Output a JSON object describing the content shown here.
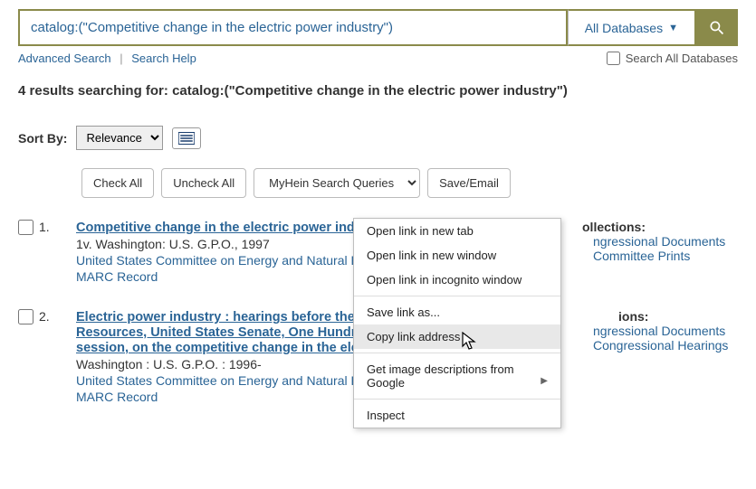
{
  "search": {
    "query": "catalog:(\"Competitive change in the electric power industry\")",
    "db_label": "All Databases",
    "advanced": "Advanced Search",
    "help": "Search Help",
    "search_all": "Search All Databases"
  },
  "results_header": {
    "prefix": "4 results searching for: ",
    "query": "catalog:(\"Competitive change in the electric power industry\")"
  },
  "sort": {
    "label": "Sort By:",
    "value": "Relevance"
  },
  "actions": {
    "check_all": "Check All",
    "uncheck_all": "Uncheck All",
    "myhein": "MyHein Search Queries",
    "save": "Save/Email"
  },
  "context_menu": {
    "open_tab": "Open link in new tab",
    "open_window": "Open link in new window",
    "open_incognito": "Open link in incognito window",
    "save_as": "Save link as...",
    "copy_addr": "Copy link address",
    "img_desc": "Get image descriptions from Google",
    "inspect": "Inspect"
  },
  "results": [
    {
      "num": "1.",
      "title": "Competitive change in the electric power industry",
      "line1": "1v. Washington: U.S. G.P.O., 1997",
      "org": "United States Committee on Energy and Natural R",
      "marc": "MARC Record",
      "coll_hdr": "Collections:",
      "coll1": "Congressional Documents",
      "coll2": "Committee Prints"
    },
    {
      "num": "2.",
      "title": "Electric power industry : hearings before the Com",
      "title2": "Resources, United States Senate, One Hundred Fo",
      "title3": "session, on the competitive change in the electric",
      "line1": "Washington : U.S. G.P.O. : 1996-",
      "org": "United States Committee on Energy and Natural R",
      "marc": "MARC Record",
      "coll_hdr": "ions:",
      "coll1": "Congressional Documents",
      "coll2": "Congressional Hearings"
    }
  ]
}
